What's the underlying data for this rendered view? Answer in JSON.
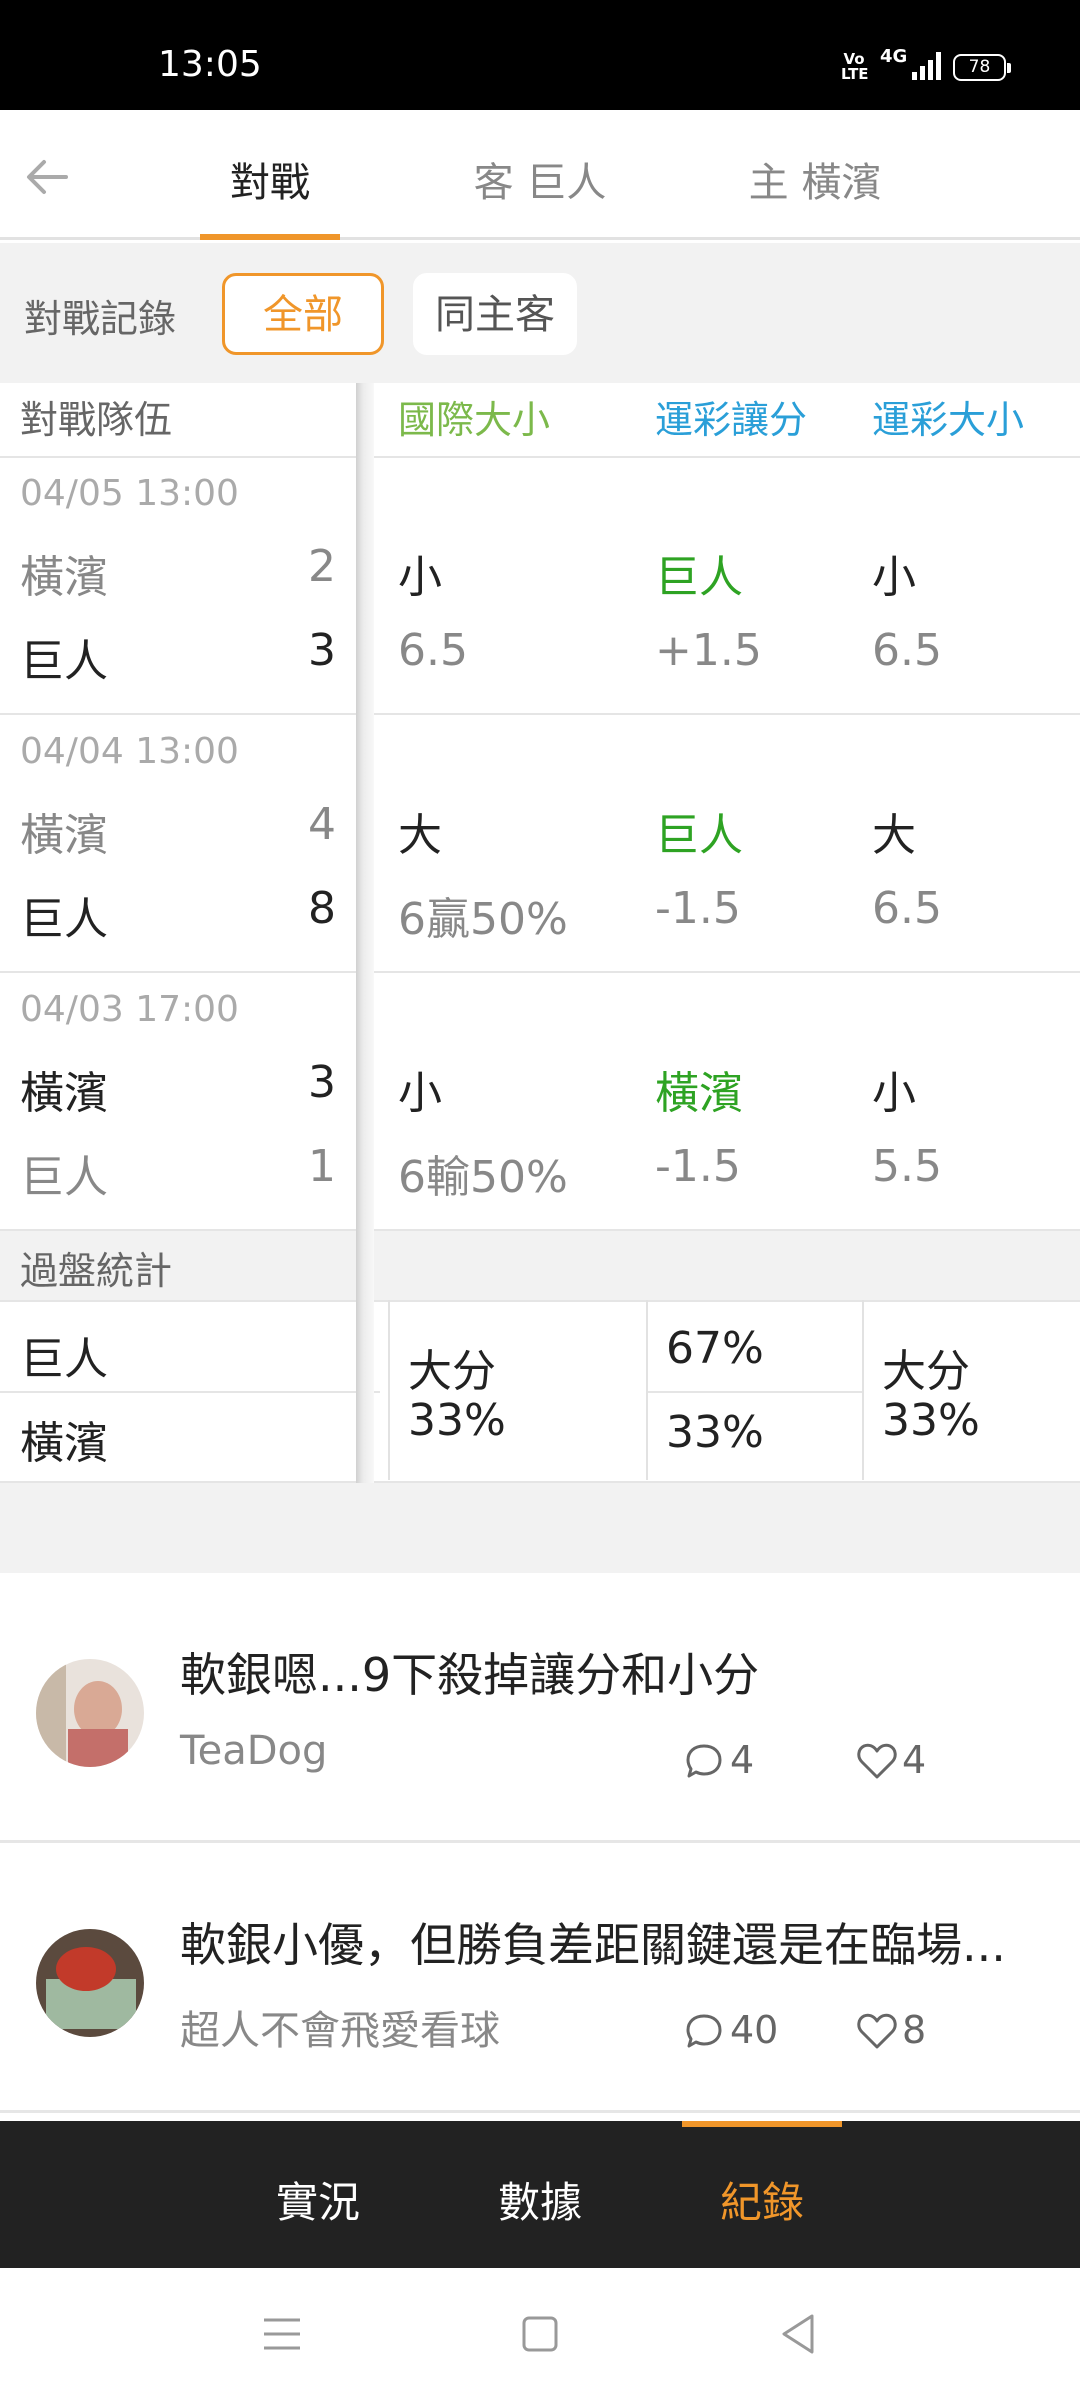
{
  "status_bar": {
    "time": "13:05",
    "volte": "Vo LTE",
    "network": "4G",
    "battery": "78"
  },
  "header": {
    "tabs": [
      "對戰",
      "客 巨人",
      "主 橫濱"
    ],
    "active_tab": 0
  },
  "filter": {
    "label": "對戰記錄",
    "options": [
      "全部",
      "同主客"
    ],
    "selected": 0
  },
  "table": {
    "headers": [
      "對戰隊伍",
      "國際大小",
      "運彩讓分",
      "運彩大小"
    ],
    "matches": [
      {
        "date": "04/05 13:00",
        "teams": [
          {
            "name": "橫濱",
            "score": "2"
          },
          {
            "name": "巨人",
            "score": "3"
          }
        ],
        "intl": {
          "result": "小",
          "line": "6.5"
        },
        "spread": {
          "result": "巨人",
          "line": "+1.5"
        },
        "total": {
          "result": "小",
          "line": "6.5"
        }
      },
      {
        "date": "04/04 13:00",
        "teams": [
          {
            "name": "橫濱",
            "score": "4"
          },
          {
            "name": "巨人",
            "score": "8"
          }
        ],
        "intl": {
          "result": "大",
          "line": "6贏50%"
        },
        "spread": {
          "result": "巨人",
          "line": "-1.5"
        },
        "total": {
          "result": "大",
          "line": "6.5"
        }
      },
      {
        "date": "04/03 17:00",
        "teams": [
          {
            "name": "橫濱",
            "score": "3"
          },
          {
            "name": "巨人",
            "score": "1"
          }
        ],
        "intl": {
          "result": "小",
          "line": "6輸50%"
        },
        "spread": {
          "result": "橫濱",
          "line": "-1.5"
        },
        "total": {
          "result": "小",
          "line": "5.5"
        }
      }
    ],
    "stats": {
      "title": "過盤統計",
      "teams": [
        "巨人",
        "橫濱"
      ],
      "intl": {
        "label": "大分",
        "pct": "33%"
      },
      "spread": [
        "67%",
        "33%"
      ],
      "total": {
        "label": "大分",
        "pct": "33%"
      }
    }
  },
  "posts": [
    {
      "title": "軟銀嗯...9下殺掉讓分和小分",
      "author": "TeaDog",
      "comments": "4",
      "likes": "4"
    },
    {
      "title": "軟銀小優，但勝負差距關鍵還是在臨場...",
      "author": "超人不會飛愛看球",
      "comments": "40",
      "likes": "8"
    }
  ],
  "bottom_nav": {
    "items": [
      "實況",
      "數據",
      "紀錄"
    ],
    "active": 2
  },
  "colors": {
    "accent": "#f0962a",
    "green": "#2ea323",
    "blue": "#2a9fd8",
    "lime": "#7cb94b"
  }
}
